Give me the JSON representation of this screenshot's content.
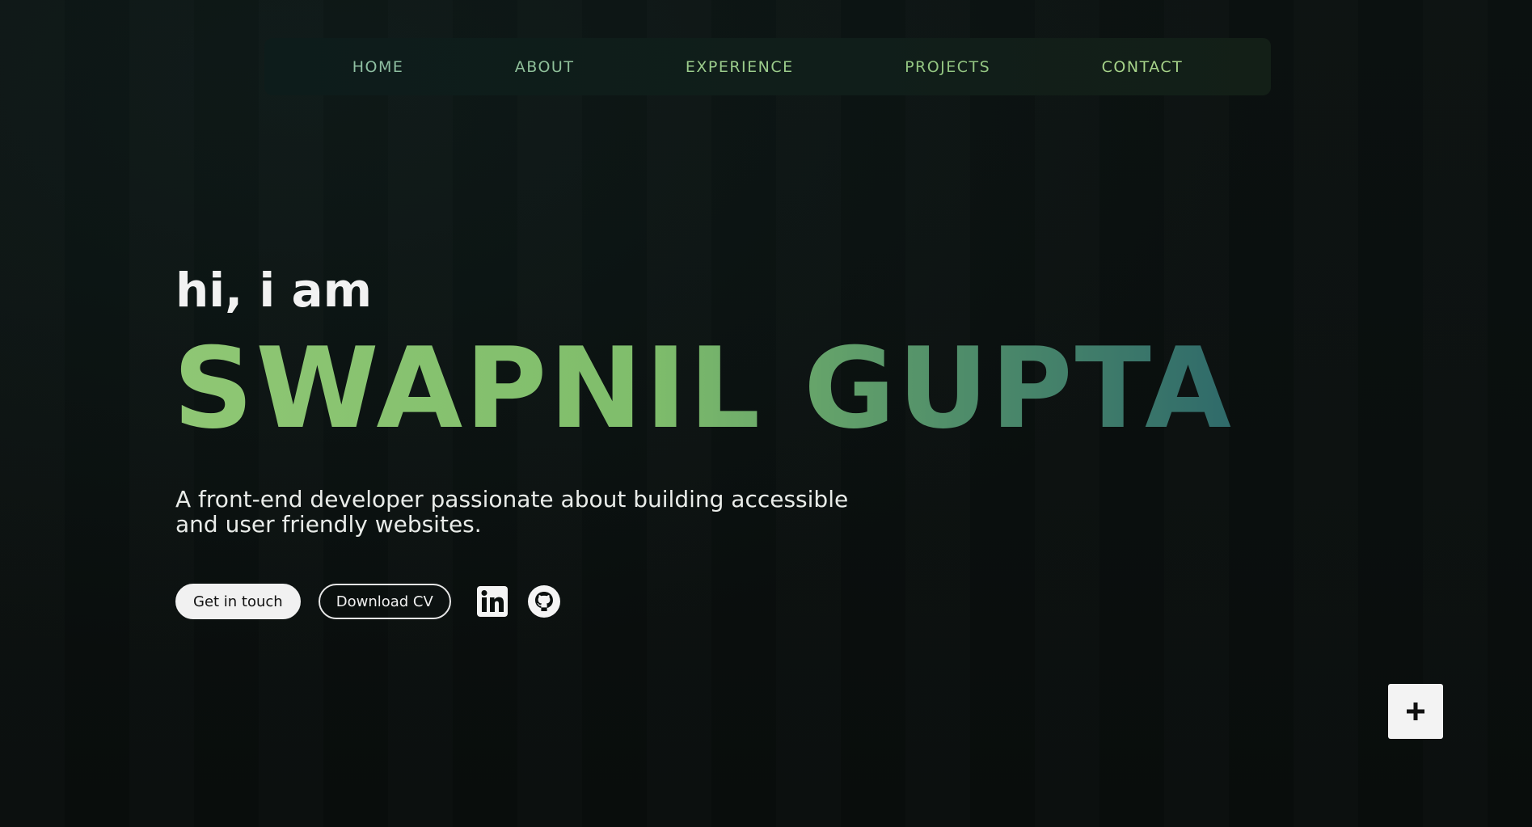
{
  "nav": {
    "items": [
      {
        "label": "HOME",
        "color": "#8fbfa2"
      },
      {
        "label": "ABOUT",
        "color": "#8fc09a"
      },
      {
        "label": "EXPERIENCE",
        "color": "#9ccd8c"
      },
      {
        "label": "PROJECTS",
        "color": "#94c682"
      },
      {
        "label": "CONTACT",
        "color": "#a7d48a"
      }
    ]
  },
  "hero": {
    "greeting": "hi, i am",
    "name": "SWAPNIL GUPTA",
    "tagline": "A front-end developer passionate about building accessible and user friendly websites.",
    "primary_button": "Get in touch",
    "secondary_button": "Download CV"
  },
  "social": {
    "linkedin_icon": "linkedin-icon",
    "github_icon": "github-icon"
  },
  "fab": {
    "icon": "plus-icon"
  },
  "colors": {
    "background": "#0a0f0e",
    "name_gradient_start": "#8fc774",
    "name_gradient_end": "#2f6a6a",
    "text": "#f2f2f2"
  }
}
